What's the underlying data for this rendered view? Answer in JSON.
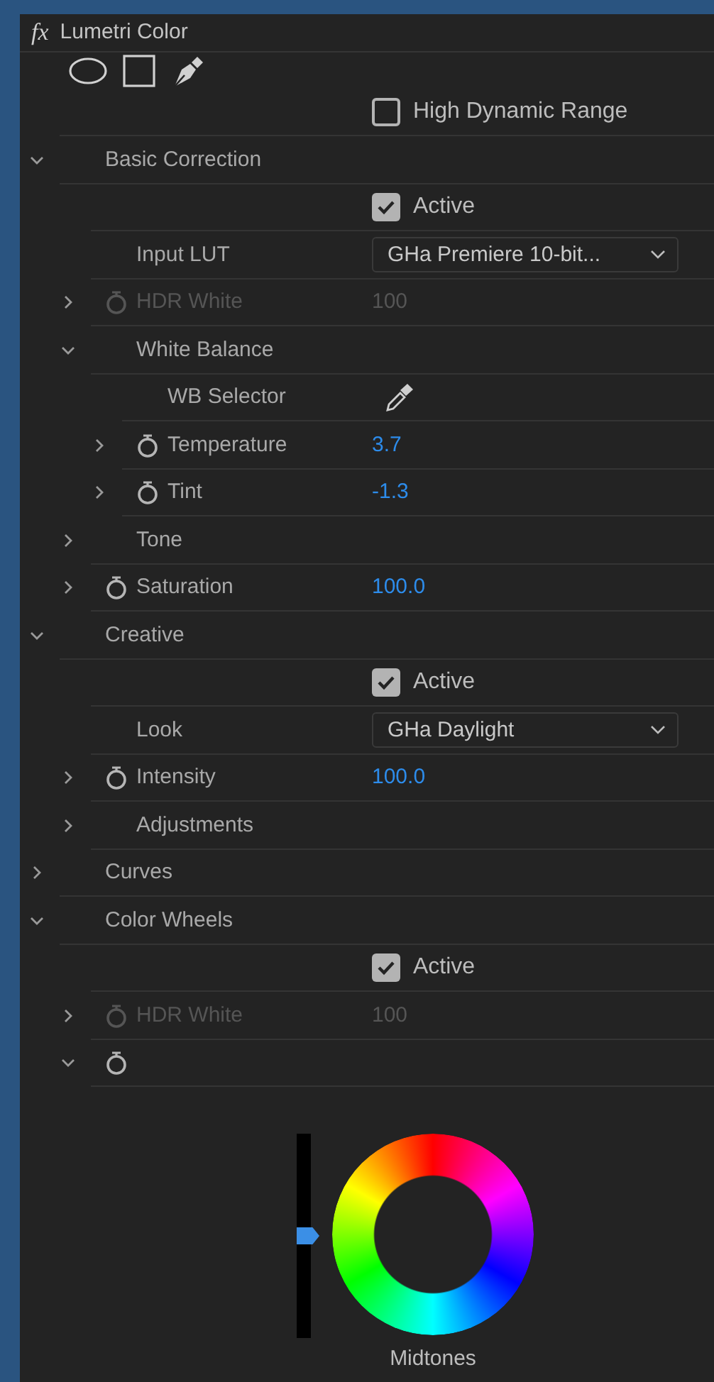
{
  "panel": {
    "badge": "fx",
    "title": "Lumetri Color"
  },
  "mask_tools": [
    {
      "kind": "ellipse"
    },
    {
      "kind": "rectangle"
    },
    {
      "kind": "pen"
    }
  ],
  "rows": [
    {
      "kind": "checkbox",
      "label": "High Dynamic Range",
      "checked": false
    },
    {
      "kind": "group",
      "label": "Basic Correction",
      "expanded": true,
      "children": [
        {
          "kind": "checkbox",
          "label": "Active",
          "checked": true
        },
        {
          "kind": "dropdown",
          "label": "Input LUT",
          "value": "GHa Premiere 10-bit..."
        },
        {
          "kind": "param",
          "label": "HDR White",
          "value": "100",
          "expanded": false,
          "disabled": true
        },
        {
          "kind": "group",
          "label": "White Balance",
          "expanded": true,
          "children": [
            {
              "kind": "eyedropper",
              "label": "WB Selector"
            },
            {
              "kind": "param",
              "label": "Temperature",
              "value": "3.7",
              "expanded": false,
              "disabled": false
            },
            {
              "kind": "param",
              "label": "Tint",
              "value": "-1.3",
              "expanded": false,
              "disabled": false
            }
          ]
        },
        {
          "kind": "group",
          "label": "Tone",
          "expanded": false
        },
        {
          "kind": "param",
          "label": "Saturation",
          "value": "100.0",
          "expanded": false,
          "disabled": false
        }
      ]
    },
    {
      "kind": "group",
      "label": "Creative",
      "expanded": true,
      "children": [
        {
          "kind": "checkbox",
          "label": "Active",
          "checked": true
        },
        {
          "kind": "dropdown",
          "label": "Look",
          "value": "GHa Daylight"
        },
        {
          "kind": "param",
          "label": "Intensity",
          "value": "100.0",
          "expanded": false,
          "disabled": false
        },
        {
          "kind": "group",
          "label": "Adjustments",
          "expanded": false
        }
      ]
    },
    {
      "kind": "group",
      "label": "Curves",
      "expanded": false
    },
    {
      "kind": "group",
      "label": "Color Wheels",
      "expanded": true,
      "children": [
        {
          "kind": "checkbox",
          "label": "Active",
          "checked": true
        },
        {
          "kind": "param",
          "label": "HDR White",
          "value": "100",
          "expanded": false,
          "disabled": true
        },
        {
          "kind": "wheel",
          "expanded": true,
          "wheel": {
            "label": "Midtones",
            "level": 0.5
          }
        }
      ]
    }
  ]
}
